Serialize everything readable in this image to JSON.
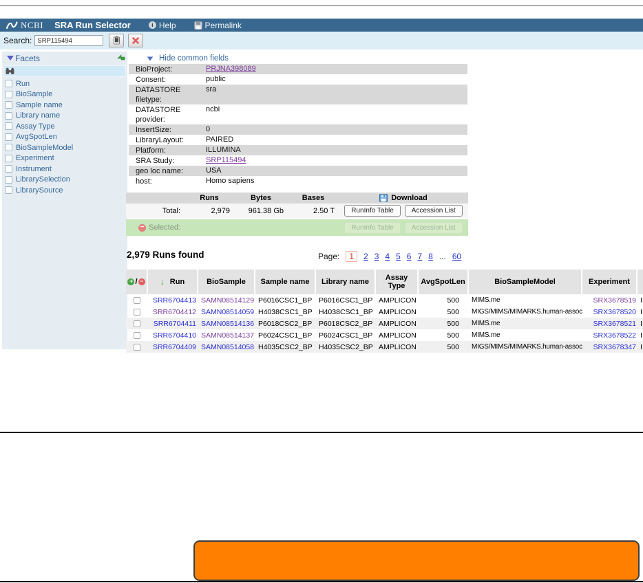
{
  "colors": {
    "navbar_blue": "#38688f",
    "search_band": "#ddeef7",
    "sidebar_bg": "#e6edf2",
    "gray_row": "#d8d8d8",
    "zebra_row": "#f0f0f0",
    "selected_green": "#c7e7ba",
    "link_blue": "#2b2fd4",
    "visited_purple": "#7b3e9d",
    "facet_link": "#336699",
    "current_page_red": "#d02b10",
    "annotation_orange": "#ff8000"
  },
  "icons": {
    "ncbi-logo": "white s-curve swoosh",
    "help-icon": "info circle",
    "permalink-icon": "floppy disk",
    "lock-icon": "padlock",
    "clear-icon": "red x",
    "facets-triangle": "down triangle",
    "facet-collapse-icon": "green bent arrow",
    "binoculars-icon": "binoculars",
    "download-icon": "blue floppy disk",
    "add-icon": "green plus circle",
    "remove-icon": "red minus circle",
    "selected-remove-icon": "red minus circle",
    "sort-desc-icon": "green down arrow"
  },
  "navbar": {
    "brand": "NCBI",
    "title": "SRA Run Selector",
    "help_label": "Help",
    "permalink_label": "Permalink"
  },
  "search": {
    "label": "Search:",
    "value": "SRP115494"
  },
  "facets": {
    "title": "Facets",
    "items": [
      "Run",
      "BioSample",
      "Sample name",
      "Library name",
      "Assay Type",
      "AvgSpotLen",
      "BioSampleModel",
      "Experiment",
      "Instrument",
      "LibrarySelection",
      "LibrarySource"
    ]
  },
  "common_fields": {
    "toggle_label": "Hide common fields",
    "rows": [
      {
        "label": "BioProject:",
        "value": "PRJNA398089",
        "link": true
      },
      {
        "label": "Consent:",
        "value": "public"
      },
      {
        "label": "DATASTORE filetype:",
        "value": "sra"
      },
      {
        "label": "DATASTORE provider:",
        "value": "ncbi"
      },
      {
        "label": "InsertSize:",
        "value": "0"
      },
      {
        "label": "LibraryLayout:",
        "value": "PAIRED"
      },
      {
        "label": "Platform:",
        "value": "ILLUMINA"
      },
      {
        "label": "SRA Study:",
        "value": "SRP115494",
        "link": true
      },
      {
        "label": "geo loc name:",
        "value": "USA"
      },
      {
        "label": "host:",
        "value": "Homo sapiens"
      }
    ]
  },
  "totals": {
    "col_headers": {
      "runs": "Runs",
      "bytes": "Bytes",
      "bases": "Bases",
      "download": "Download"
    },
    "total_label": "Total:",
    "total": {
      "runs": "2,979",
      "bytes": "961.38 Gb",
      "bases": "2.50 T"
    },
    "buttons": {
      "runinfo": "RunInfo Table",
      "accession": "Accession List"
    },
    "selected_label": "Selected:"
  },
  "results": {
    "count_text": "2,979 Runs found",
    "pagination": {
      "label": "Page:",
      "current": "1",
      "pages": [
        "2",
        "3",
        "4",
        "5",
        "6",
        "7",
        "8"
      ],
      "ellipsis": "...",
      "last_page": "60"
    },
    "table": {
      "headers": {
        "selector_plus": "+",
        "selector_slash": "/",
        "selector_minus": "-",
        "run": "Run",
        "biosample": "BioSample",
        "sample_name": "Sample name",
        "library_name": "Library name",
        "assay_type": "Assay Type",
        "avg_spot_len": "AvgSpotLen",
        "biosample_model": "BioSampleModel",
        "experiment": "Experiment"
      },
      "rows": [
        {
          "run": "SRR6704413",
          "biosample": "SAMN08514129",
          "sample_name": "P6016CSC1_BP",
          "library_name": "P6016CSC1_BP",
          "assay_type": "AMPLICON",
          "avg_spot_len": "500",
          "biosample_model": "MIMS.me",
          "experiment": "SRX3678519",
          "clipped": "I",
          "visited": [
            "biosample",
            "experiment"
          ]
        },
        {
          "run": "SRR6704412",
          "biosample": "SAMN08514059",
          "sample_name": "H4038CSC1_BP",
          "library_name": "H4038CSC1_BP",
          "assay_type": "AMPLICON",
          "avg_spot_len": "500",
          "biosample_model": "MIGS/MIMS/MIMARKS.human-associated",
          "experiment": "SRX3678520",
          "clipped": "I",
          "visited": [
            "run"
          ]
        },
        {
          "run": "SRR6704411",
          "biosample": "SAMN08514136",
          "sample_name": "P6018CSC2_BP",
          "library_name": "P6018CSC2_BP",
          "assay_type": "AMPLICON",
          "avg_spot_len": "500",
          "biosample_model": "MIMS.me",
          "experiment": "SRX3678521",
          "clipped": "I",
          "visited": []
        },
        {
          "run": "SRR6704410",
          "biosample": "SAMN08514137",
          "sample_name": "P6024CSC1_BP",
          "library_name": "P6024CSC1_BP",
          "assay_type": "AMPLICON",
          "avg_spot_len": "500",
          "biosample_model": "MIMS.me",
          "experiment": "SRX3678522",
          "clipped": "I",
          "visited": [
            "biosample"
          ]
        },
        {
          "run": "SRR6704409",
          "biosample": "SAMN08514058",
          "sample_name": "H4035CSC2_BP",
          "library_name": "H4035CSC2_BP",
          "assay_type": "AMPLICON",
          "avg_spot_len": "500",
          "biosample_model": "MIGS/MIMS/MIMARKS.human-associated",
          "experiment": "SRX3678347",
          "clipped": "I",
          "visited": []
        }
      ]
    }
  }
}
